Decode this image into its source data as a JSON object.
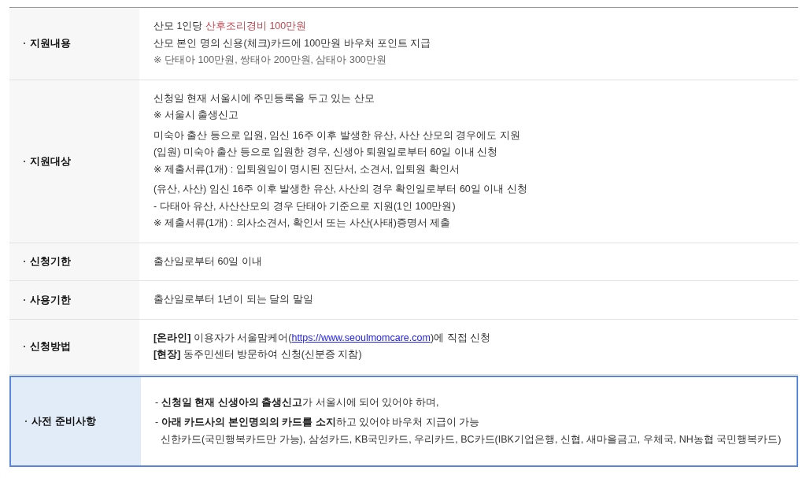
{
  "rows": [
    {
      "label": "지원내용",
      "highlighted": false,
      "blocks": [
        [
          [
            {
              "kind": "plain",
              "text": "산모 1인당 "
            },
            {
              "kind": "accent",
              "text": "산후조리경비 100만원"
            }
          ],
          [
            {
              "kind": "plain",
              "text": "산모 본인 명의 신용(체크)카드에 100만원 바우처 포인트 지급"
            }
          ],
          [
            {
              "kind": "note",
              "text": "※ 단태아 100만원, 쌍태아 200만원, 삼태아 300만원"
            }
          ]
        ]
      ]
    },
    {
      "label": "지원대상",
      "highlighted": false,
      "blocks": [
        [
          [
            {
              "kind": "plain",
              "text": "신청일 현재 서울시에 주민등록을 두고 있는 산모"
            }
          ],
          [
            {
              "kind": "plain",
              "text": "※ 서울시 출생신고"
            }
          ]
        ],
        [
          [
            {
              "kind": "plain",
              "text": "미숙아 출산 등으로 입원, 임신 16주 이후 발생한 유산, 사산 산모의 경우에도 지원"
            }
          ],
          [
            {
              "kind": "plain",
              "text": "(입원) 미숙아 출산 등으로 입원한 경우, 신생아 퇴원일로부터 60일 이내 신청"
            }
          ],
          [
            {
              "kind": "plain",
              "text": "※ 제출서류(1개) : 입퇴원일이 명시된 진단서, 소견서, 입퇴원 확인서"
            }
          ]
        ],
        [
          [
            {
              "kind": "plain",
              "text": "(유산, 사산) 임신 16주 이후 발생한 유산, 사산의 경우 확인일로부터 60일 이내 신청"
            }
          ],
          [
            {
              "kind": "plain",
              "text": "- 다태아 유산, 사산산모의 경우 단태아 기준으로 지원(1인 100만원)"
            }
          ],
          [
            {
              "kind": "plain",
              "text": "※ 제출서류(1개) : 의사소견서, 확인서 또는 사산(사태)증명서 제출"
            }
          ]
        ]
      ]
    },
    {
      "label": "신청기한",
      "highlighted": false,
      "blocks": [
        [
          [
            {
              "kind": "plain",
              "text": "출산일로부터 60일 이내"
            }
          ]
        ]
      ]
    },
    {
      "label": "사용기한",
      "highlighted": false,
      "blocks": [
        [
          [
            {
              "kind": "plain",
              "text": "출산일로부터 1년이 되는 달의 말일"
            }
          ]
        ]
      ]
    },
    {
      "label": "신청방법",
      "highlighted": false,
      "blocks": [
        [
          [
            {
              "kind": "strong",
              "text": "[온라인]"
            },
            {
              "kind": "plain",
              "text": " 이용자가 서울맘케어("
            },
            {
              "kind": "link",
              "text": "https://www.seoulmomcare.com"
            },
            {
              "kind": "plain",
              "text": ")에 직접 신청"
            }
          ],
          [
            {
              "kind": "strong",
              "text": "[현장]"
            },
            {
              "kind": "plain",
              "text": " 동주민센터 방문하여 신청(신분증 지참)"
            }
          ]
        ]
      ]
    },
    {
      "label": "사전 준비사항",
      "highlighted": true,
      "blocks": [
        [
          [
            {
              "kind": "plain",
              "text": "- "
            },
            {
              "kind": "strong",
              "text": "신청일 현재 신생아의 출생신고"
            },
            {
              "kind": "plain",
              "text": "가 서울시에 되어 있어야 하며,"
            }
          ]
        ],
        [
          [
            {
              "kind": "plain",
              "text": "- "
            },
            {
              "kind": "strong",
              "text": "아래 카드사의 본인명의의 카드를 소지"
            },
            {
              "kind": "plain",
              "text": "하고 있어야 바우처 지급이 가능"
            }
          ],
          [
            {
              "kind": "plain",
              "text": "  신한카드(국민행복카드만 가능), 삼성카드, KB국민카드, 우리카드, BC카드(IBK기업은행, 신협, 새마을금고, 우체국, NH농협 국민행복카드)"
            }
          ]
        ]
      ]
    }
  ]
}
